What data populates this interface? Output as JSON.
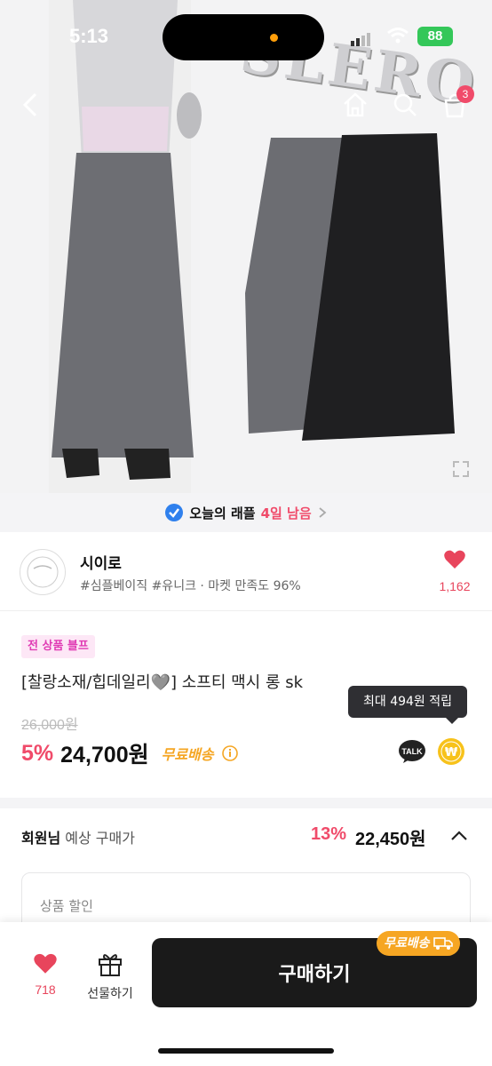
{
  "status": {
    "time": "5:13",
    "battery": "88"
  },
  "hero": {
    "watermark": "SLERO"
  },
  "nav": {
    "cart_count": "3"
  },
  "raffle": {
    "text": "오늘의 래플",
    "highlight": "4일 남음"
  },
  "shop": {
    "name": "시이로",
    "tags": "#심플베이직 #유니크 · 마켓 만족도 96%",
    "like_count": "1,162"
  },
  "product": {
    "sale_badge": "전 상품 블프",
    "title": "[찰랑소재/힙데일리🩶] 소프티 맥시 롱 sk",
    "original_price": "26,000원",
    "discount": "5%",
    "price": "24,700원",
    "free_shipping": "무료배송",
    "point_tooltip": "최대 494원 적립",
    "talk_label": "TALK"
  },
  "member": {
    "label_bold": "회원님",
    "label_rest": " 예상 구매가",
    "discount": "13%",
    "price": "22,450원"
  },
  "discount_box": {
    "label": "상품 할인"
  },
  "bottom": {
    "like_count": "718",
    "gift_label": "선물하기",
    "buy_label": "구매하기",
    "ship_chip": "무료배송"
  },
  "colors": {
    "accent": "#f04b6a",
    "orange": "#f6a623",
    "dark": "#1a1a1a"
  }
}
